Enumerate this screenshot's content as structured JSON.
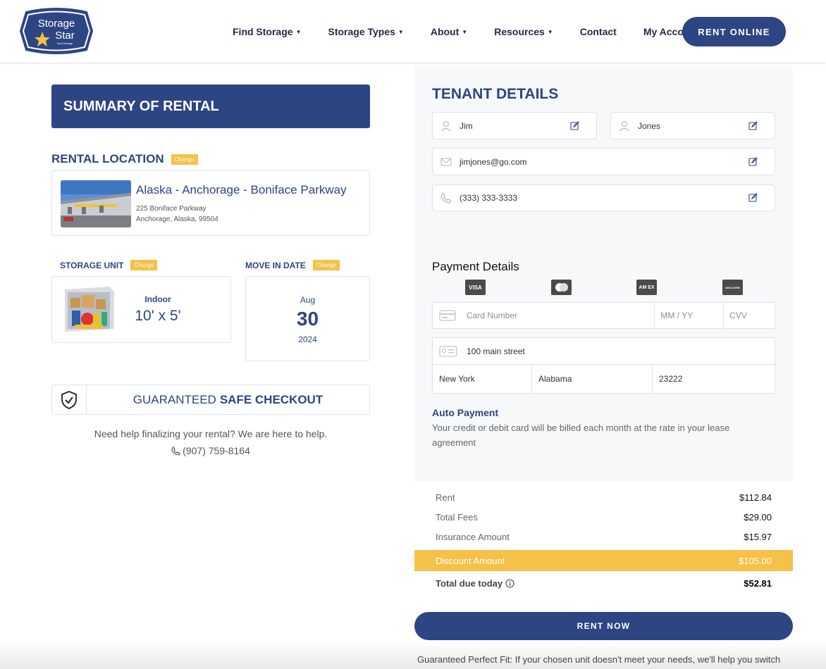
{
  "header": {
    "logo_line1": "Storage",
    "logo_line2": "Star",
    "logo_sub": "Self-Storage",
    "nav": [
      {
        "label": "Find Storage",
        "has_caret": true
      },
      {
        "label": "Storage Types",
        "has_caret": true
      },
      {
        "label": "About",
        "has_caret": true
      },
      {
        "label": "Resources",
        "has_caret": true
      },
      {
        "label": "Contact",
        "has_caret": false
      },
      {
        "label": "My Account",
        "has_caret": false
      }
    ],
    "cta": "RENT ONLINE"
  },
  "summary": {
    "title": "SUMMARY OF RENTAL",
    "rental_location_title": "RENTAL LOCATION",
    "change_label": "Change",
    "location": {
      "name": "Alaska - Anchorage - Boniface Parkway",
      "address_line1": "225 Boniface Parkway",
      "address_line2": "Anchorage, Alaska, 99504"
    },
    "storage_unit_title": "STORAGE UNIT",
    "unit": {
      "type": "Indoor",
      "size": "10' x 5'"
    },
    "move_in_title": "MOVE IN DATE",
    "move_in": {
      "month": "Aug",
      "day": "30",
      "year": "2024"
    },
    "safe_checkout_prefix": "GUARANTEED",
    "safe_checkout_bold": "SAFE CHECKOUT",
    "help_text": "Need help finalizing your rental? We are here to help.",
    "help_phone": "(907) 759-8164"
  },
  "tenant": {
    "title": "TENANT DETAILS",
    "first_name": "Jim",
    "last_name": "Jones",
    "email": "jimjones@go.com",
    "phone": "(333) 333-3333"
  },
  "payment": {
    "title": "Payment Details",
    "card_brands": [
      "VISA",
      "mastercard",
      "AM EX",
      "DISCOVER"
    ],
    "card_number_placeholder": "Card Number",
    "expiry_placeholder": "MM / YY",
    "cvv_placeholder": "CVV",
    "street": "100 main street",
    "city": "New York",
    "state": "Alabama",
    "zip": "23222",
    "auto_title": "Auto Payment",
    "auto_text": "Your credit or debit card will be billed each month at the rate in your lease agreement"
  },
  "pricing": {
    "rent_label": "Rent",
    "rent_value": "$112.84",
    "fees_label": "Total Fees",
    "fees_value": "$29.00",
    "insurance_label": "Insurance Amount",
    "insurance_value": "$15.97",
    "discount_label": "Discount Amount",
    "discount_value": "$105.00",
    "total_label": "Total due today",
    "total_value": "$52.81"
  },
  "actions": {
    "rent_now": "RENT NOW",
    "guarantee_text": "Guaranteed Perfect Fit: If your chosen unit doesn't meet your needs, we'll help you switch"
  },
  "colors": {
    "primary": "#2e4583",
    "accent": "#f5c148"
  }
}
